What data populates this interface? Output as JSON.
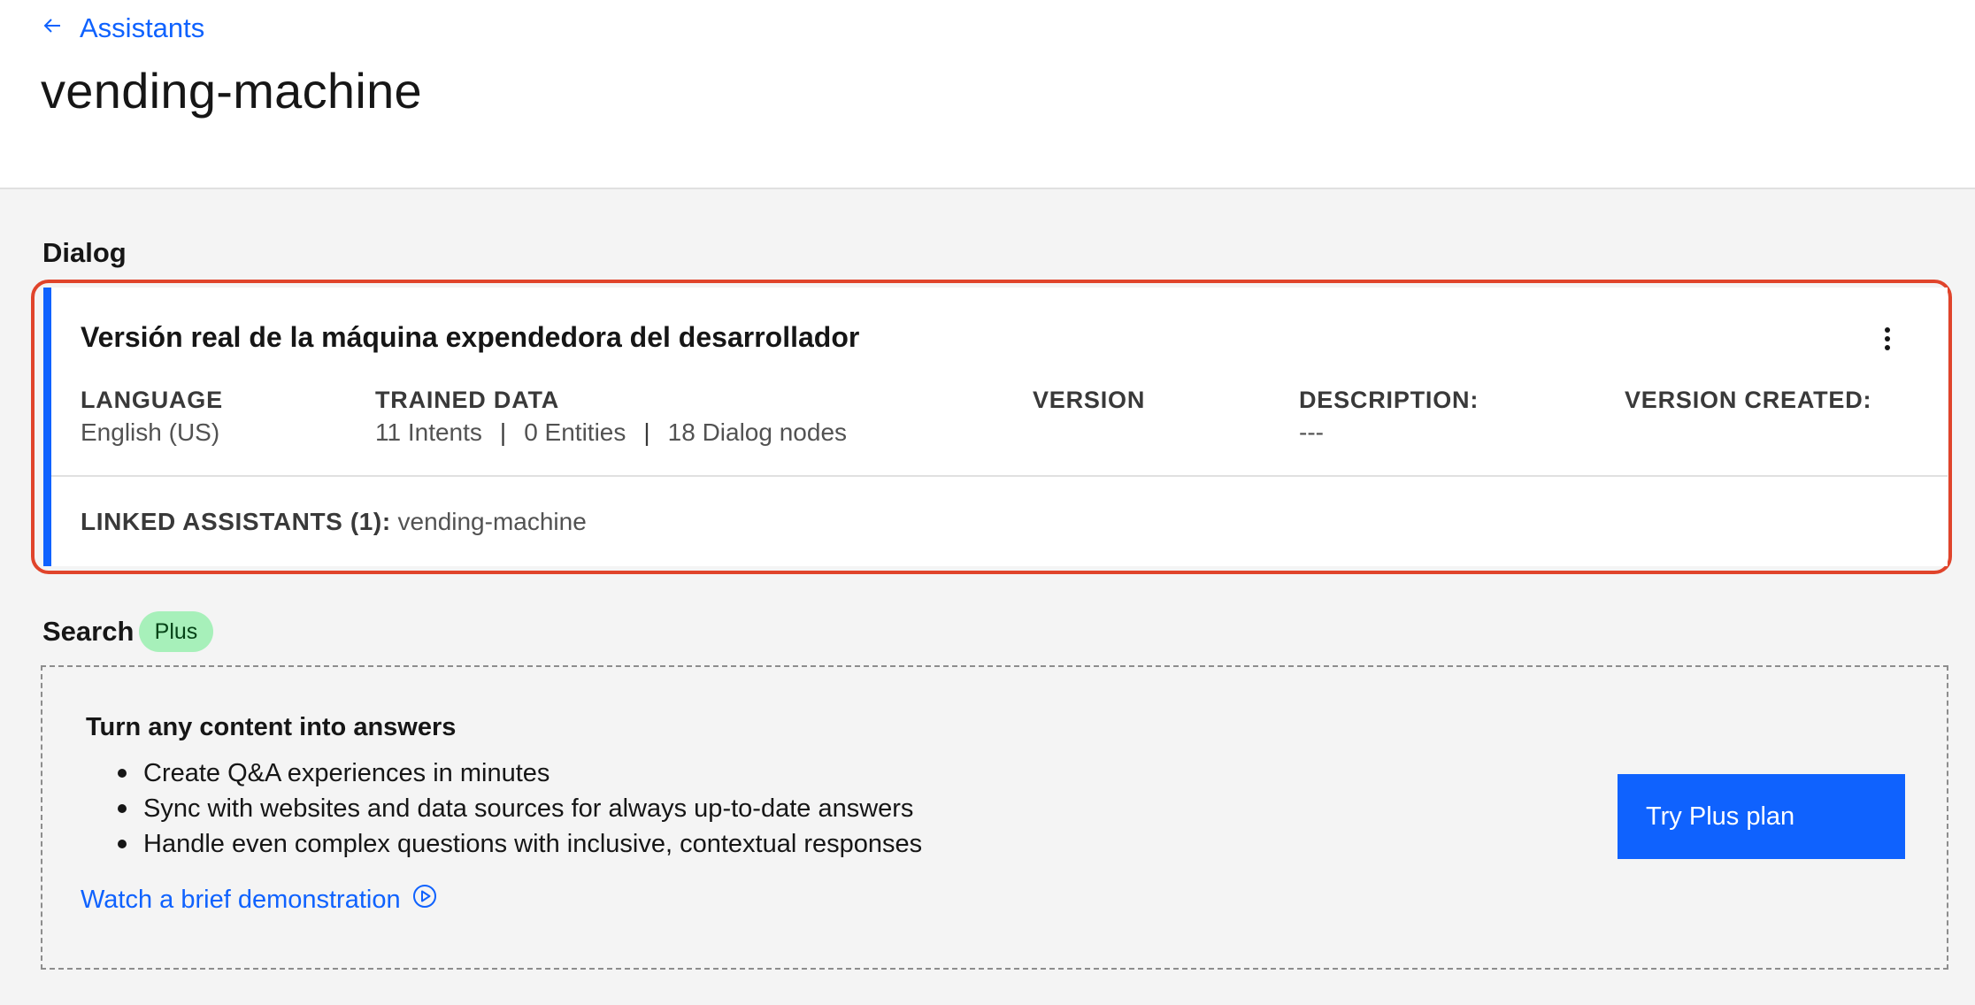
{
  "header": {
    "back_label": "Assistants",
    "title": "vending-machine"
  },
  "dialog": {
    "section_title": "Dialog",
    "card": {
      "title": "Versión real de la máquina expendedora del desarrollador",
      "language_label": "LANGUAGE",
      "language_value": "English (US)",
      "trained_label": "TRAINED DATA",
      "intents": "11 Intents",
      "entities": "0 Entities",
      "dialog_nodes": "18 Dialog nodes",
      "separator": "|",
      "version_label": "VERSION",
      "description_label": "DESCRIPTION:",
      "description_value": "---",
      "version_created_label": "VERSION CREATED:",
      "linked_label": "LINKED ASSISTANTS (1):",
      "linked_value": "vending-machine"
    }
  },
  "search": {
    "section_title": "Search",
    "tag": "Plus",
    "heading": "Turn any content into answers",
    "bullets": [
      "Create Q&A experiences in minutes",
      "Sync with websites and data sources for always up-to-date answers",
      "Handle even complex questions with inclusive, contextual responses"
    ],
    "demo_link": "Watch a brief demonstration",
    "cta": "Try Plus plan"
  },
  "colors": {
    "accent": "#0f62fe",
    "highlight": "#e0442b",
    "tag_bg": "#a7f0ba",
    "page_bg": "#f4f4f4"
  },
  "icons": {
    "back": "arrow-left-icon",
    "overflow": "overflow-menu-vertical-icon",
    "play": "play-circle-icon"
  }
}
